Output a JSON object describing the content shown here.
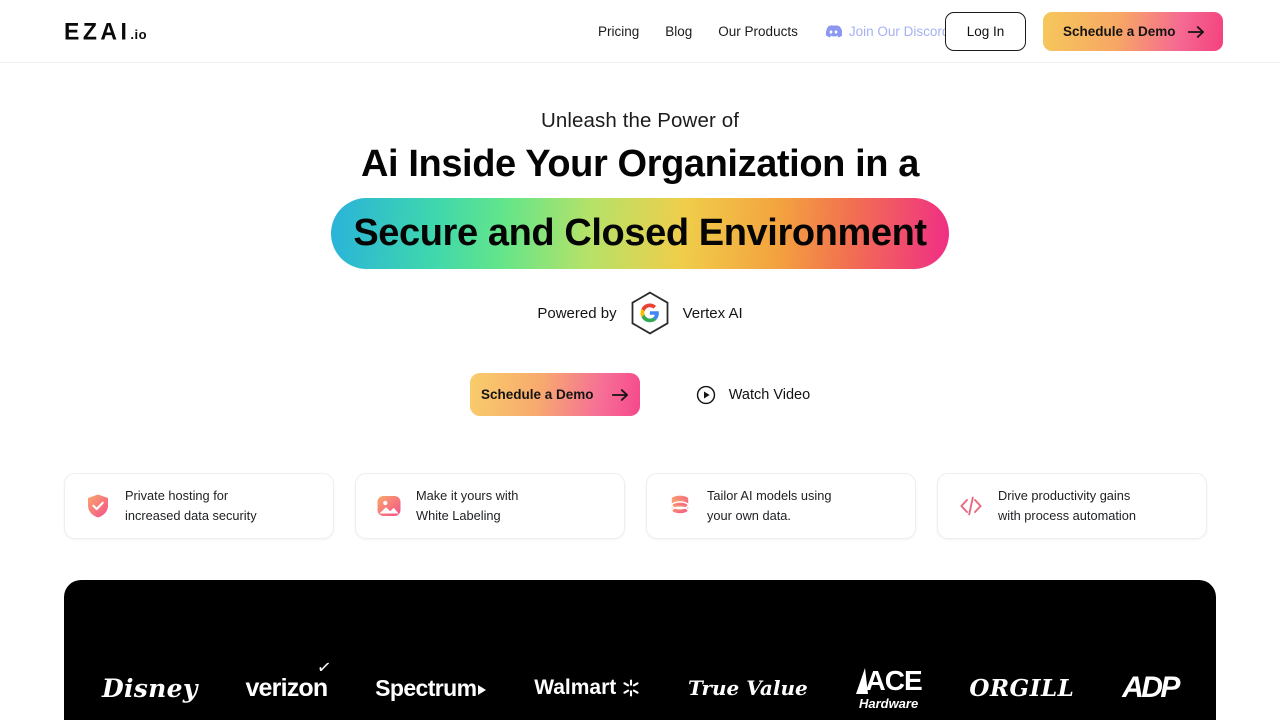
{
  "header": {
    "logo_main": "EZAI",
    "logo_suffix": ".io",
    "nav": [
      {
        "label": "Pricing",
        "name": "nav-pricing"
      },
      {
        "label": "Blog",
        "name": "nav-blog"
      },
      {
        "label": "Our Products",
        "name": "nav-our-products"
      }
    ],
    "discord_label": "Join Our Discord",
    "login_label": "Log In",
    "demo_label": "Schedule a Demo"
  },
  "hero": {
    "eyebrow": "Unleash the Power of",
    "headline": "Ai Inside Your Organization in a",
    "highlight": "Secure and Closed Environment",
    "powered_prefix": "Powered by",
    "powered_product": "Vertex AI",
    "cta_primary": "Schedule a Demo",
    "cta_secondary": "Watch Video"
  },
  "features": [
    {
      "line1": "Private hosting for",
      "line2": "increased data security",
      "icon": "shield-check-icon"
    },
    {
      "line1": "Make it yours with",
      "line2": "White Labeling",
      "icon": "image-icon"
    },
    {
      "line1": "Tailor AI models using",
      "line2": "your own data.",
      "icon": "database-icon"
    },
    {
      "line1": "Drive productivity gains",
      "line2": "with process automation",
      "icon": "code-icon"
    }
  ],
  "logos": [
    {
      "name": "disney",
      "label": "Disney"
    },
    {
      "name": "verizon",
      "label": "verizon"
    },
    {
      "name": "spectrum",
      "label": "Spectrum"
    },
    {
      "name": "walmart",
      "label": "Walmart"
    },
    {
      "name": "truevalue",
      "label": "True Value"
    },
    {
      "name": "ace",
      "label": "ACE",
      "sub": "Hardware"
    },
    {
      "name": "orgill",
      "label": "ORGILL"
    },
    {
      "name": "adp",
      "label": "ADP"
    }
  ],
  "colors": {
    "gradient_start": "#29b3da",
    "gradient_mid_green": "#63e58a",
    "gradient_mid_yellow": "#f0cd4a",
    "gradient_end": "#f02d86",
    "cta_start": "#f8cd6b",
    "cta_end": "#f5488b",
    "discord": "#a6b0f2",
    "strip_bg": "#000000"
  }
}
